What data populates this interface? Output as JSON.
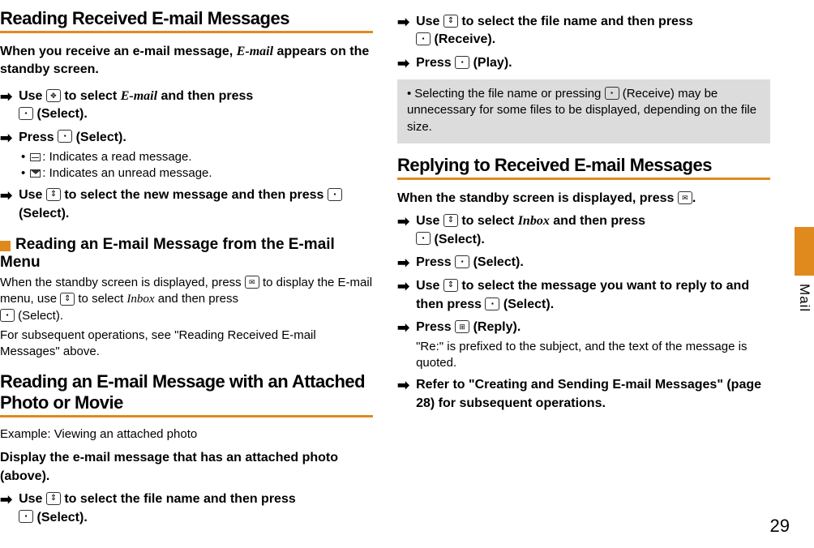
{
  "sideLabel": "Mail",
  "pageNumber": "29",
  "left": {
    "h1_reading": "Reading Received E-mail Messages",
    "intro_a": "When you receive an e-mail message, ",
    "intro_em": "E-mail",
    "intro_b": " appears on the standby screen.",
    "s1a": "Use ",
    "s1b": " to select ",
    "s1em": "E-mail",
    "s1c": " and then press ",
    "s1d": " (Select).",
    "s2a": "Press ",
    "s2b": " (Select).",
    "bul1": ": Indicates a read message.",
    "bul2": ": Indicates an unread message.",
    "s3a": "Use ",
    "s3b": " to select the new message and then press ",
    "s3c": " (Select).",
    "h2_menu": "Reading an E-mail Message from the E-mail Menu",
    "p1a": "When the standby screen is displayed, press ",
    "p1b": " to display the E-mail menu, use ",
    "p1c": " to select ",
    "p1em": "Inbox",
    "p1d": " and then press ",
    "p1e": " (Select).",
    "p2": "For subsequent operations, see \"Reading Received E-mail Messages\" above.",
    "h1_attach": "Reading an E-mail Message with an Attached Photo or Movie",
    "example": "Example: Viewing an attached photo",
    "disp": "Display the e-mail message that has an attached photo (above).",
    "s4a": "Use ",
    "s4b": " to select the file name and then press ",
    "s4c": " (Select)."
  },
  "right": {
    "s5a": "Use ",
    "s5b": " to select the file name and then press ",
    "s5c": " (Receive).",
    "s6a": "Press ",
    "s6b": " (Play).",
    "note_a": "Selecting the file name or pressing ",
    "note_b": " (Receive) may be unnecessary for some files to be displayed, depending on the file size.",
    "h1_reply": "Replying to Received E-mail Messages",
    "intro2a": "When the standby screen is displayed, press ",
    "intro2b": ".",
    "r1a": "Use ",
    "r1b": " to select ",
    "r1em": "Inbox",
    "r1c": " and then press ",
    "r1d": " (Select).",
    "r2a": "Press ",
    "r2b": " (Select).",
    "r3a": "Use ",
    "r3b": " to select the message you want to reply to and then press ",
    "r3c": " (Select).",
    "r4a": "Press ",
    "r4b": " (Reply).",
    "r4sub": "\"Re:\" is prefixed to the subject, and the text of the message is quoted.",
    "r5": "Refer to \"Creating and Sending E-mail Messages\" (page 28) for subsequent operations."
  }
}
